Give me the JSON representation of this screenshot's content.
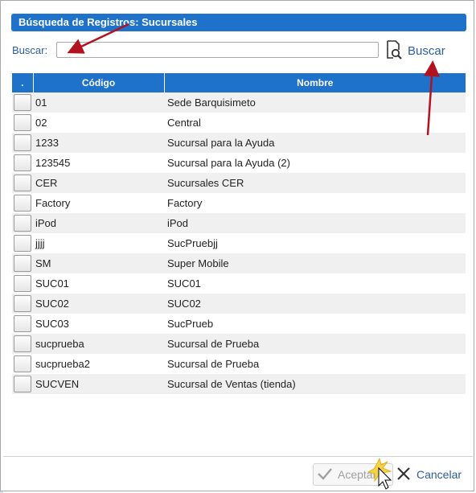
{
  "dialog": {
    "title": "Búsqueda de Registros: Sucursales",
    "search_label": "Buscar:",
    "search_value": "",
    "search_placeholder": "",
    "search_button_label": "Buscar"
  },
  "table": {
    "headers": [
      ".",
      "Código",
      "Nombre"
    ],
    "rows": [
      {
        "code": "01",
        "name": "Sede Barquisimeto"
      },
      {
        "code": "02",
        "name": "Central"
      },
      {
        "code": "1233",
        "name": "Sucursal para la Ayuda"
      },
      {
        "code": "123545",
        "name": "Sucursal para la Ayuda (2)"
      },
      {
        "code": "CER",
        "name": "Sucursales CER"
      },
      {
        "code": "Factory",
        "name": "Factory"
      },
      {
        "code": "iPod",
        "name": "iPod"
      },
      {
        "code": "jjjj",
        "name": "SucPruebjj"
      },
      {
        "code": "SM",
        "name": "Super Mobile"
      },
      {
        "code": "SUC01",
        "name": "SUC01"
      },
      {
        "code": "SUC02",
        "name": "SUC02"
      },
      {
        "code": "SUC03",
        "name": "SucPrueb"
      },
      {
        "code": "sucprueba",
        "name": "Sucursal de Prueba"
      },
      {
        "code": "sucprueba2",
        "name": "Sucursal de Prueba"
      },
      {
        "code": "SUCVEN",
        "name": "Sucursal de Ventas (tienda)"
      }
    ]
  },
  "footer": {
    "accept_label": "Aceptar",
    "cancel_label": "Cancelar"
  },
  "colors": {
    "header_blue": "#1f72c9",
    "link_blue": "#2b5d9b",
    "annotation_arrow": "#b3121f"
  },
  "icons": [
    "search-document-icon",
    "checkmark-icon",
    "close-x-icon",
    "cursor-click-icon"
  ]
}
